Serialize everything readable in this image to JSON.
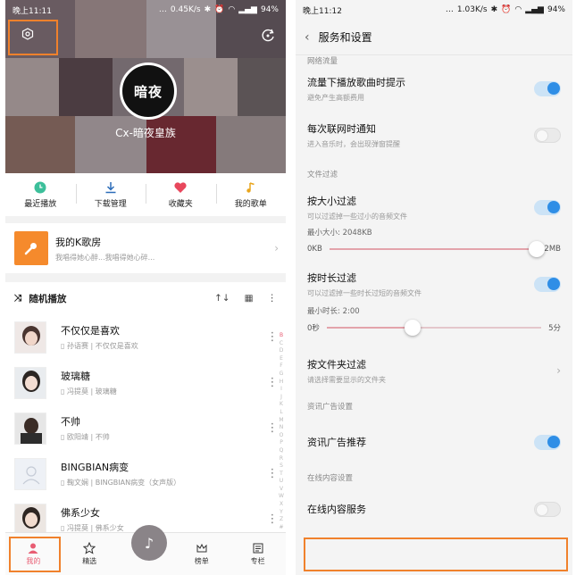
{
  "left": {
    "status": {
      "time": "晚上11:11",
      "speed": "0.45K/s",
      "battery": "94%"
    },
    "profile": {
      "avatar_text": "暗夜",
      "username": "Cx-暗夜皇族"
    },
    "quick": [
      {
        "icon": "clock-icon",
        "label": "最近播放"
      },
      {
        "icon": "download-icon",
        "label": "下载管理"
      },
      {
        "icon": "heart-icon",
        "label": "收藏夹"
      },
      {
        "icon": "music-note-icon",
        "label": "我的歌单"
      }
    ],
    "ktv": {
      "title": "我的K歌房",
      "subtitle": "我唱得她心醉...我唱得她心碎..."
    },
    "list_header": {
      "label": "随机播放"
    },
    "songs": [
      {
        "title": "不仅仅是喜欢",
        "subtitle": "孙语赛 | 不仅仅是喜欢"
      },
      {
        "title": "玻璃糖",
        "subtitle": "冯提莫 | 玻璃糖"
      },
      {
        "title": "不帅",
        "subtitle": "欧阳靖 | 不帅"
      },
      {
        "title": "BINGBIAN病变",
        "subtitle": "鞠文娴 | BINGBIAN病变（女声版）"
      },
      {
        "title": "佛系少女",
        "subtitle": "冯提莫 | 佛系少女"
      }
    ],
    "index_letters": [
      "B",
      "C",
      "D",
      "E",
      "F",
      "G",
      "H",
      "I",
      "J",
      "K",
      "L",
      "M",
      "N",
      "O",
      "P",
      "Q",
      "R",
      "S",
      "T",
      "U",
      "V",
      "W",
      "X",
      "Y",
      "Z",
      "#"
    ],
    "nav": [
      {
        "icon": "person-icon",
        "label": "我的",
        "active": true
      },
      {
        "icon": "star-icon",
        "label": "精选",
        "active": false
      },
      {
        "icon": "crown-icon",
        "label": "榜单",
        "active": false
      },
      {
        "icon": "columns-icon",
        "label": "专栏",
        "active": false
      }
    ],
    "colors": {
      "accent": "#e85d73",
      "highlight": "#f0812c"
    }
  },
  "right": {
    "status": {
      "time": "晚上11:12",
      "speed": "1.03K/s",
      "battery": "94%"
    },
    "title": "服务和设置",
    "sections": {
      "network": "网络流量",
      "filter": "文件过滤",
      "ads": "资讯广告设置",
      "online": "在线内容设置"
    },
    "rows": {
      "flow_tip": {
        "title": "流量下播放歌曲时提示",
        "subtitle": "避免产生高额费用",
        "on": true
      },
      "net_notify": {
        "title": "每次联网时通知",
        "subtitle": "进入音乐时，会出现弹窗提醒",
        "on": false
      },
      "size_filter": {
        "title": "按大小过滤",
        "subtitle": "可以过滤掉一些过小的音频文件",
        "on": true
      },
      "min_size": {
        "label": "最小大小: 2048KB",
        "min": "0KB",
        "max": "2MB",
        "value": 1.0
      },
      "dur_filter": {
        "title": "按时长过滤",
        "subtitle": "可以过滤掉一些时长过短的音频文件",
        "on": true
      },
      "min_dur": {
        "label": "最小时长: 2:00",
        "min": "0秒",
        "max": "5分",
        "value": 0.4
      },
      "folder_filter": {
        "title": "按文件夹过滤",
        "subtitle": "请选择需要显示的文件夹"
      },
      "ads_rec": {
        "title": "资讯广告推荐",
        "on": true
      },
      "online_service": {
        "title": "在线内容服务",
        "on": false
      }
    }
  }
}
